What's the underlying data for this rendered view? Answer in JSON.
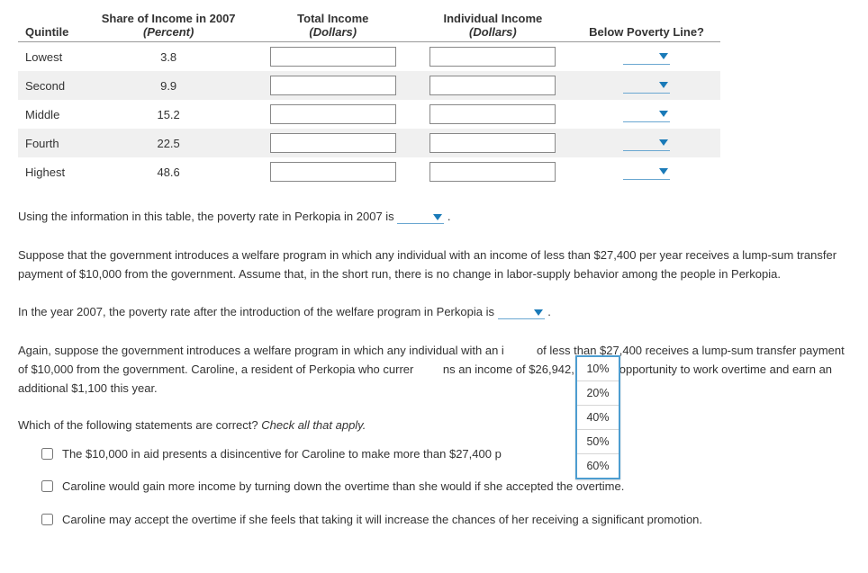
{
  "table": {
    "headers": {
      "quintile": "Quintile",
      "share": "Share of Income in 2007",
      "share_sub": "(Percent)",
      "total": "Total Income",
      "total_sub": "(Dollars)",
      "individual": "Individual Income",
      "individual_sub": "(Dollars)",
      "poverty": "Below Poverty Line?"
    },
    "rows": [
      {
        "name": "Lowest",
        "share": "3.8"
      },
      {
        "name": "Second",
        "share": "9.9"
      },
      {
        "name": "Middle",
        "share": "15.2"
      },
      {
        "name": "Fourth",
        "share": "22.5"
      },
      {
        "name": "Highest",
        "share": "48.6"
      }
    ]
  },
  "text": {
    "q1_before": "Using the information in this table, the poverty rate in Perkopia in 2007 is ",
    "q1_after": " .",
    "p2": "Suppose that the government introduces a welfare program in which any individual with an income of less than $27,400 per year receives a lump-sum transfer payment of $10,000 from the government. Assume that, in the short run, there is no change in labor-supply behavior among the people in Perkopia.",
    "q2_before": "In the year 2007, the poverty rate after the introduction of the welfare program in Perkopia is ",
    "q2_after": " .",
    "p3a": "Again, suppose the government introduces a welfare program in which any individual with an i",
    "p3b": "of less than $27,400 receives a lump-sum transfer payment of $10,000 from the government. Caroline, a resident of Perkopia who currer",
    "p3c": "ns an income of $26,942, has the opportunity to work overtime and earn an additional $1,100 this year.",
    "check_prompt": "Which of the following statements are correct? ",
    "check_instr": "Check all that apply."
  },
  "dropdown": {
    "options": [
      "10%",
      "20%",
      "40%",
      "50%",
      "60%"
    ]
  },
  "checks": [
    "The $10,000 in aid presents a disincentive for Caroline to make more than $27,400 p",
    "Caroline would gain more income by turning down the overtime than she would if she accepted the overtime.",
    "Caroline may accept the overtime if she feels that taking it will increase the chances of her receiving a significant promotion."
  ]
}
